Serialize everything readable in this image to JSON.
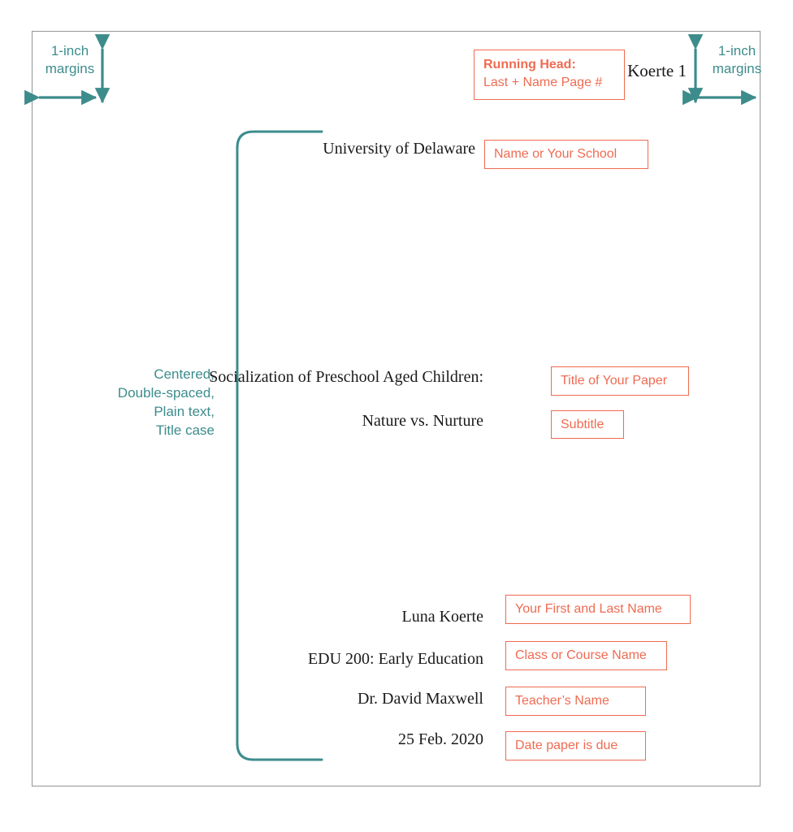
{
  "diagram": {
    "title": "MLA Formatted Title Page Annotation Diagram",
    "colors": {
      "annotation_teal": "#3d8c8c",
      "callout_coral": "#ef6b52",
      "page_border_gray": "#939598",
      "document_text": "#1a1a1a",
      "page_background": "#ffffff"
    }
  },
  "margins": {
    "left_label": "1-inch\nmargins",
    "right_label": "1-inch\nmargins"
  },
  "brace_note": {
    "lines": "Centered,\nDouble-spaced,\nPlain text,\nTitle case"
  },
  "document": {
    "running_head_number": "Koerte 1",
    "school": "University of Delaware",
    "title": "Socialization of Preschool Aged Children:",
    "subtitle": "Nature vs. Nurture",
    "author": "Luna Koerte",
    "course": "EDU 200: Early Education",
    "teacher": "Dr. David Maxwell",
    "date": "25 Feb. 2020"
  },
  "callouts": {
    "running_head_strong": "Running Head:",
    "running_head_detail": "Last + Name Page #",
    "school": "Name or Your School",
    "title": "Title of Your Paper",
    "subtitle": "Subtitle",
    "author": "Your First and Last Name",
    "course": "Class or Course Name",
    "teacher": "Teacher’s Name",
    "date": "Date paper is due"
  }
}
